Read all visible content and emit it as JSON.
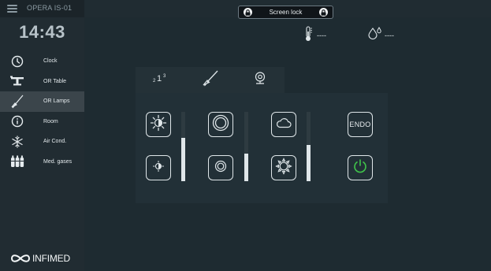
{
  "app": {
    "device_name": "OPERA IS-01",
    "time": "14:43",
    "logo_text": "INFIMED"
  },
  "sidebar": {
    "items": [
      {
        "label": "Clock",
        "icon": "clock-icon",
        "active": false
      },
      {
        "label": "OR Table",
        "icon": "or-table-icon",
        "active": false
      },
      {
        "label": "OR Lamps",
        "icon": "or-lamp-icon",
        "active": true
      },
      {
        "label": "Room",
        "icon": "info-icon",
        "active": false
      },
      {
        "label": "Air Cond.",
        "icon": "snowflake-icon",
        "active": false
      },
      {
        "label": "Med. gases",
        "icon": "gas-cylinders-icon",
        "active": false
      }
    ]
  },
  "topbar": {
    "screen_lock_label": "Screen lock"
  },
  "environment": {
    "temperature": "----",
    "humidity": "----"
  },
  "tabs": [
    {
      "name": "lamp-selection",
      "icon": "lamp-select-icon"
    },
    {
      "name": "lamp",
      "icon": "surgical-lamp-icon"
    },
    {
      "name": "camera",
      "icon": "camera-icon"
    }
  ],
  "controls": {
    "brightness_level": 0.62,
    "field_size_level": 0.4,
    "color_temp_level": 0.52,
    "endo_label": "ENDO"
  },
  "colors": {
    "background": "#1e2b31",
    "sidebar": "#212c32",
    "active_nav": "#3b454b",
    "panel": "#223037",
    "power_green": "#3fc34a",
    "icon_light": "#dfe6e9"
  }
}
